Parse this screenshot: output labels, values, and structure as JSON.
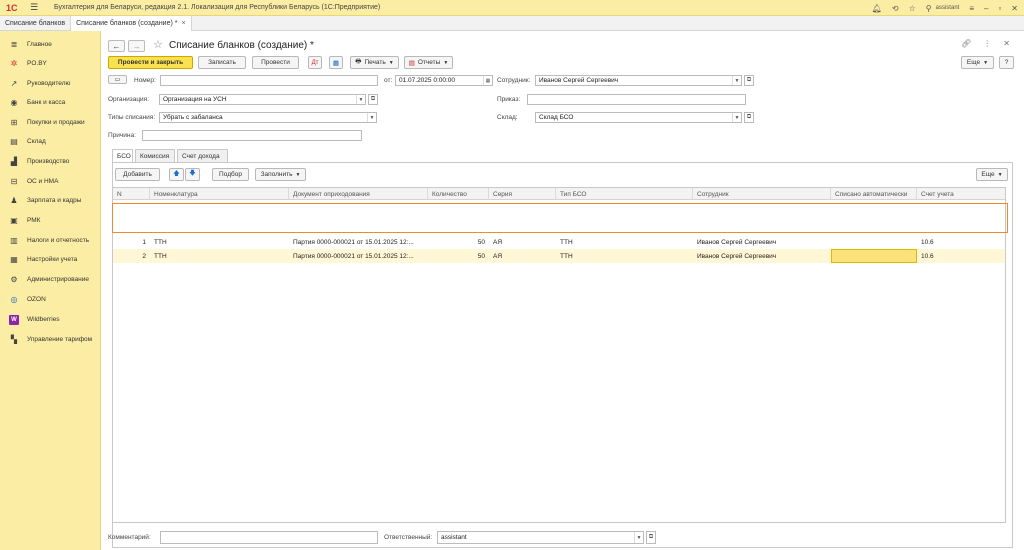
{
  "app": {
    "title": "Бухгалтерия для Беларуси, редакция 2.1. Локализация для Республики Беларусь  (1С:Предприятие)",
    "logo": "1С",
    "user": "assistant"
  },
  "tabs": [
    {
      "label": "Списание бланков"
    },
    {
      "label": "Списание бланков (создание) *",
      "close": "×"
    }
  ],
  "sidebar": {
    "items": [
      {
        "icon": "≣",
        "label": "Главное"
      },
      {
        "icon": "✲",
        "label": "PO.BY"
      },
      {
        "icon": "↗",
        "label": "Руководителю"
      },
      {
        "icon": "◉",
        "label": "Банк и касса"
      },
      {
        "icon": "⊞",
        "label": "Покупки и продажи"
      },
      {
        "icon": "▤",
        "label": "Склад"
      },
      {
        "icon": "▟",
        "label": "Производство"
      },
      {
        "icon": "⊟",
        "label": "ОС и НМА"
      },
      {
        "icon": "♟",
        "label": "Зарплата и кадры"
      },
      {
        "icon": "▣",
        "label": "РМК"
      },
      {
        "icon": "▥",
        "label": "Налоги и отчетность"
      },
      {
        "icon": "▦",
        "label": "Настройки учета"
      },
      {
        "icon": "⚙",
        "label": "Администрирование"
      },
      {
        "icon": "◎",
        "label": "OZON"
      },
      {
        "icon": "W",
        "label": "Wildberries"
      },
      {
        "icon": "▚",
        "label": "Управление тарифом"
      }
    ]
  },
  "doc": {
    "title": "Списание бланков (создание) *",
    "toolbar": {
      "post_close": "Провести и закрыть",
      "save": "Записать",
      "post": "Провести",
      "print": "Печать",
      "reports": "Отчеты",
      "more": "Еще",
      "help": "?"
    },
    "fields": {
      "number_label": "Номер:",
      "number_value": "",
      "date_label": "от:",
      "date_value": "01.07.2025  0:00:00",
      "employee_label": "Сотрудник:",
      "employee_value": "Иванов Сергей Сергеевич",
      "org_label": "Организация:",
      "org_value": "Организация на УСН",
      "order_label": "Приказ:",
      "order_value": "",
      "type_label": "Типы списания:",
      "type_value": "Убрать с забаланса",
      "warehouse_label": "Склад:",
      "warehouse_value": "Склад БСО",
      "reason_label": "Причина:",
      "reason_value": ""
    },
    "inner_tabs": [
      "БСО",
      "Комиссия",
      "Счет дохода"
    ],
    "table_toolbar": {
      "add": "Добавить",
      "pick": "Подбор",
      "fill": "Заполнить",
      "more": "Еще"
    },
    "table": {
      "columns": [
        "N",
        "Номенклатура",
        "Документ оприходования",
        "Количество",
        "Серия",
        "Тип БСО",
        "Сотрудник",
        "Списано автоматически",
        "Счет учета"
      ],
      "rows": [
        {
          "n": "1",
          "item": "ТТН",
          "doc": "Партия 0000-000021 от 15.01.2025 12:...",
          "qty": "50",
          "series": "АЯ",
          "type": "ТТН",
          "employee": "Иванов Сергей Сергеевич",
          "auto": "",
          "account": "10.6"
        },
        {
          "n": "2",
          "item": "ТТН",
          "doc": "Партия 0000-000021 от 15.01.2025 12:...",
          "qty": "50",
          "series": "АЯ",
          "type": "ТТН",
          "employee": "Иванов Сергей Сергеевич",
          "auto": "",
          "account": "10.6"
        }
      ]
    },
    "bottom": {
      "comment_label": "Комментарий:",
      "comment_value": "",
      "responsible_label": "Ответственный:",
      "responsible_value": "assistant"
    }
  },
  "colors": {
    "accent": "#fbe14e",
    "sidebar": "#fbeda3",
    "selection": "#f08a2a"
  }
}
